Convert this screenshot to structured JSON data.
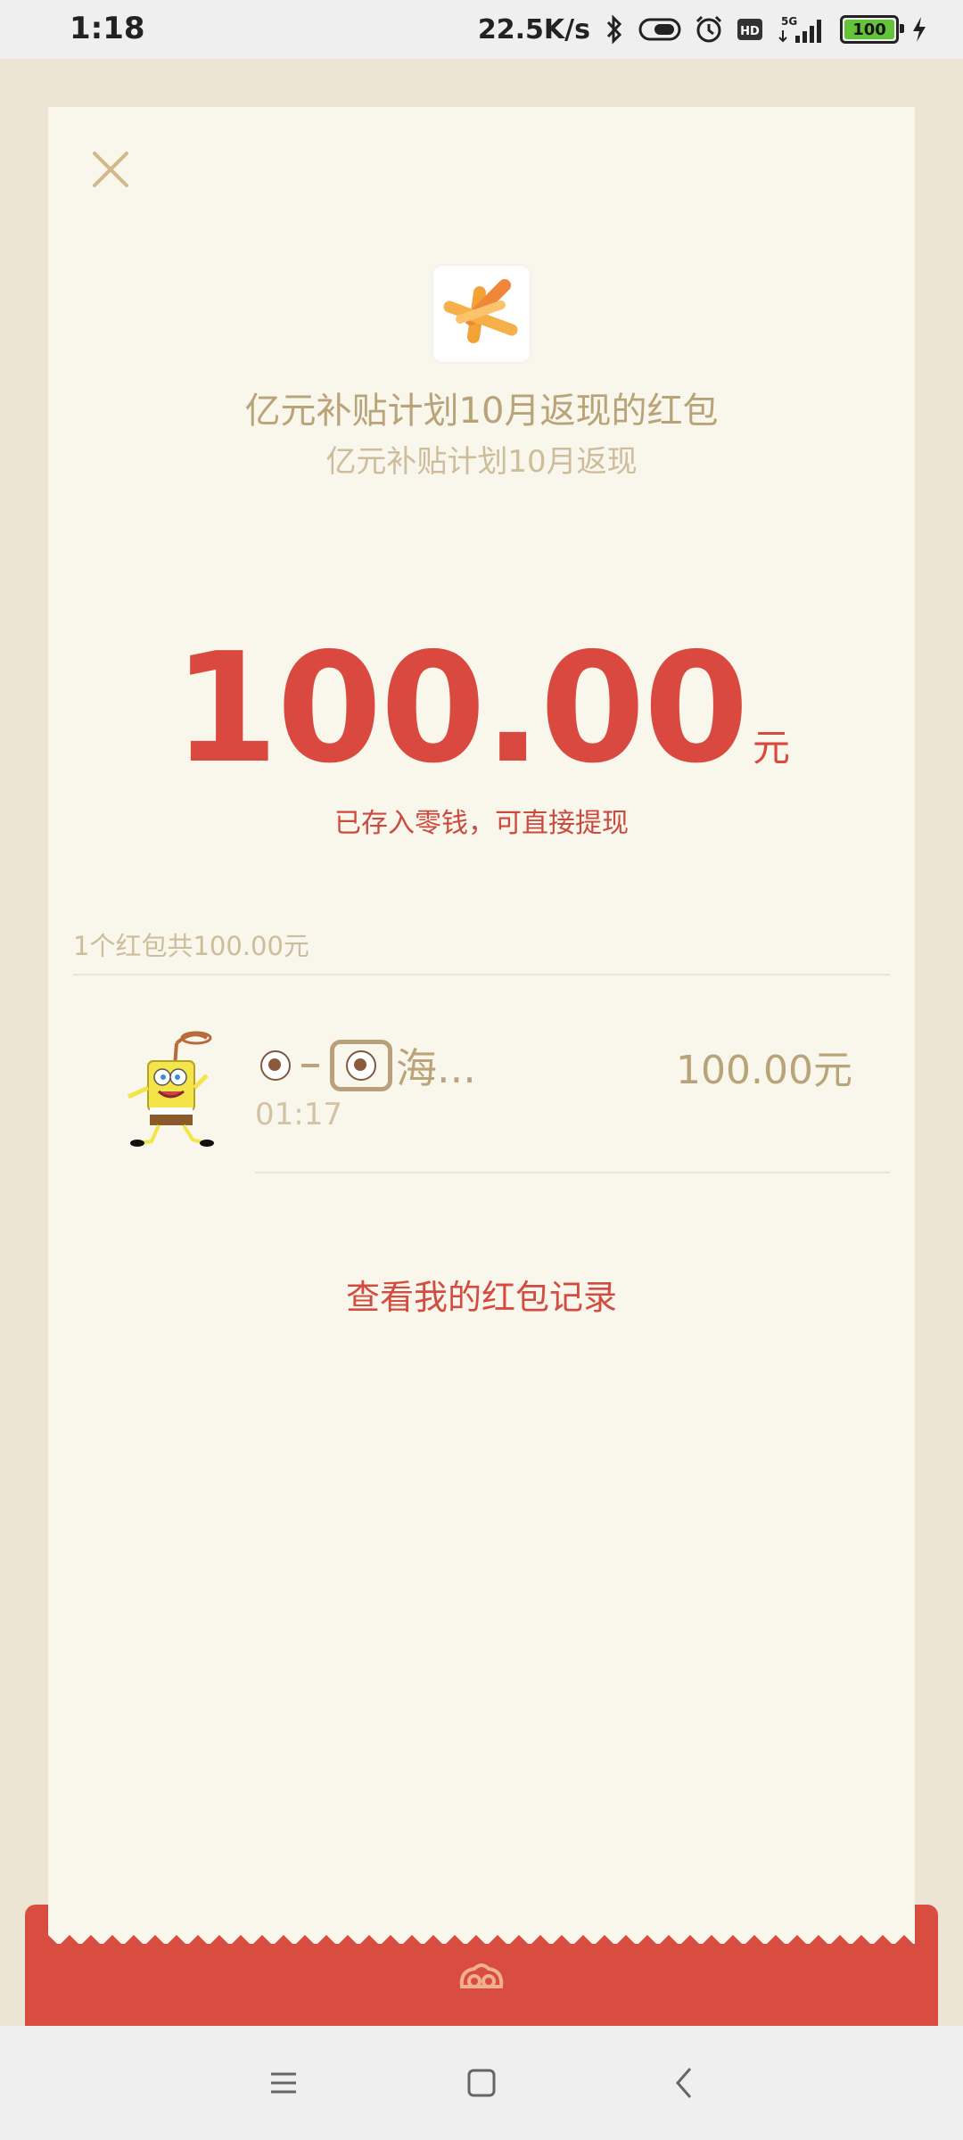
{
  "status_bar": {
    "time": "1:18",
    "network_speed": "22.5K/s",
    "battery_level": "100",
    "signal_label": "5G",
    "icons": [
      "bluetooth-icon",
      "toggle-icon",
      "alarm-icon",
      "hd-icon",
      "signal-icon",
      "battery-icon",
      "charging-icon"
    ]
  },
  "header": {
    "close_icon": "close-icon",
    "title": "亿元补贴计划10月返现的红包",
    "subtitle": "亿元补贴计划10月返现"
  },
  "amount": {
    "value": "100.00",
    "unit": "元",
    "note": "已存入零钱，可直接提现"
  },
  "summary": "1个红包共100.00元",
  "recipients": [
    {
      "name_suffix": "海...",
      "time": "01:17",
      "amount": "100.00元"
    }
  ],
  "records_link": "查看我的红包记录",
  "colors": {
    "accent_red": "#d9493f",
    "gold_text": "#b9a378",
    "paper": "#f9f6ec",
    "background": "#ede5d3"
  },
  "nav": {
    "menu_icon": "menu-icon",
    "home_icon": "home-icon",
    "back_icon": "back-icon"
  }
}
